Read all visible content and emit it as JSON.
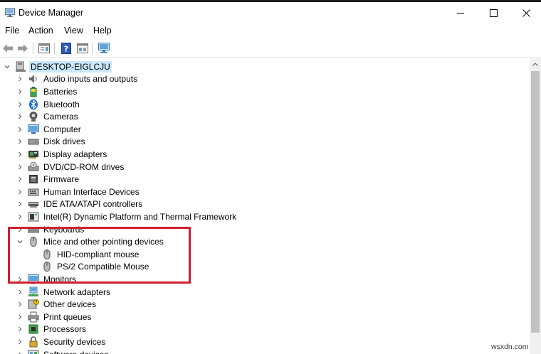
{
  "window": {
    "title": "Device Manager",
    "icon": "device-manager-icon"
  },
  "menu": {
    "file": "File",
    "action": "Action",
    "view": "View",
    "help": "Help"
  },
  "toolbar": {
    "buttons": [
      {
        "name": "back-icon"
      },
      {
        "name": "forward-icon"
      },
      {
        "name": "properties-icon"
      },
      {
        "name": "help-icon"
      },
      {
        "name": "show-hidden-icon"
      },
      {
        "name": "monitor-scan-icon"
      }
    ]
  },
  "tree": {
    "root": {
      "label": "DESKTOP-EIGLCJU",
      "expanded": true,
      "selected": true
    },
    "categories": [
      {
        "label": "Audio inputs and outputs",
        "icon": "speaker-icon"
      },
      {
        "label": "Batteries",
        "icon": "battery-icon"
      },
      {
        "label": "Bluetooth",
        "icon": "bluetooth-icon"
      },
      {
        "label": "Cameras",
        "icon": "camera-icon"
      },
      {
        "label": "Computer",
        "icon": "computer-icon"
      },
      {
        "label": "Disk drives",
        "icon": "disk-drive-icon"
      },
      {
        "label": "Display adapters",
        "icon": "display-adapter-icon"
      },
      {
        "label": "DVD/CD-ROM drives",
        "icon": "dvd-drive-icon"
      },
      {
        "label": "Firmware",
        "icon": "firmware-icon"
      },
      {
        "label": "Human Interface Devices",
        "icon": "hid-icon"
      },
      {
        "label": "IDE ATA/ATAPI controllers",
        "icon": "ide-controller-icon"
      },
      {
        "label": "Intel(R) Dynamic Platform and Thermal Framework",
        "icon": "intel-framework-icon"
      },
      {
        "label": "Keyboards",
        "icon": "keyboard-icon"
      },
      {
        "label": "Mice and other pointing devices",
        "icon": "mouse-icon",
        "expanded": true,
        "children": [
          {
            "label": "HID-compliant mouse",
            "icon": "mouse-icon"
          },
          {
            "label": "PS/2 Compatible Mouse",
            "icon": "mouse-icon"
          }
        ]
      },
      {
        "label": "Monitors",
        "icon": "monitor-icon"
      },
      {
        "label": "Network adapters",
        "icon": "network-adapter-icon"
      },
      {
        "label": "Other devices",
        "icon": "other-devices-icon"
      },
      {
        "label": "Print queues",
        "icon": "printer-icon"
      },
      {
        "label": "Processors",
        "icon": "processor-icon"
      },
      {
        "label": "Security devices",
        "icon": "security-icon"
      },
      {
        "label": "Software devices",
        "icon": "software-icon"
      }
    ]
  },
  "annotation": {
    "color": "#d01f2e"
  },
  "watermark": "wsxdn.com"
}
